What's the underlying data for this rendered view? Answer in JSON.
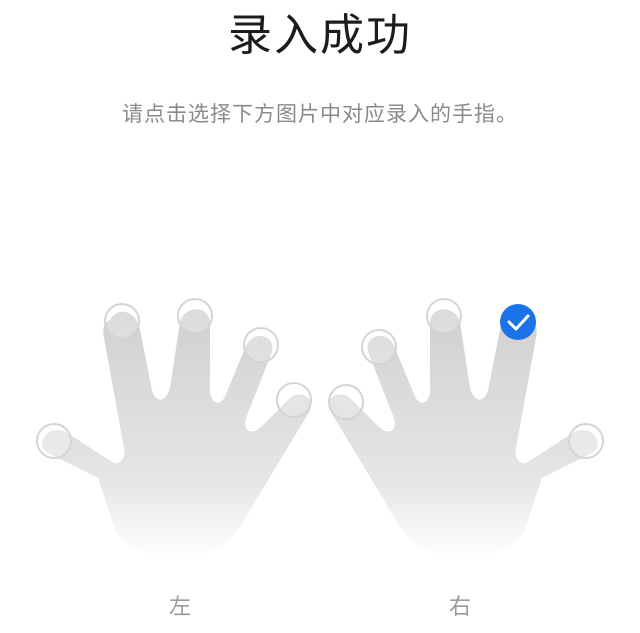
{
  "header": {
    "title": "录入成功",
    "instruction": "请点击选择下方图片中对应录入的手指。"
  },
  "hands": {
    "left": {
      "label": "左",
      "fingers": [
        {
          "name": "thumb",
          "selected": false
        },
        {
          "name": "index",
          "selected": false
        },
        {
          "name": "middle",
          "selected": false
        },
        {
          "name": "ring",
          "selected": false
        },
        {
          "name": "little",
          "selected": false
        }
      ]
    },
    "right": {
      "label": "右",
      "fingers": [
        {
          "name": "thumb",
          "selected": false
        },
        {
          "name": "index",
          "selected": false
        },
        {
          "name": "middle",
          "selected": false
        },
        {
          "name": "ring",
          "selected": true
        },
        {
          "name": "little",
          "selected": false
        }
      ]
    }
  },
  "colors": {
    "selected": "#1a73e8",
    "hand_top": "#d2d2d2",
    "hand_bottom": "#ffffff",
    "circle_outline": "#d4d4d4"
  },
  "icons": {
    "selected_marker": "checkmark-icon"
  }
}
